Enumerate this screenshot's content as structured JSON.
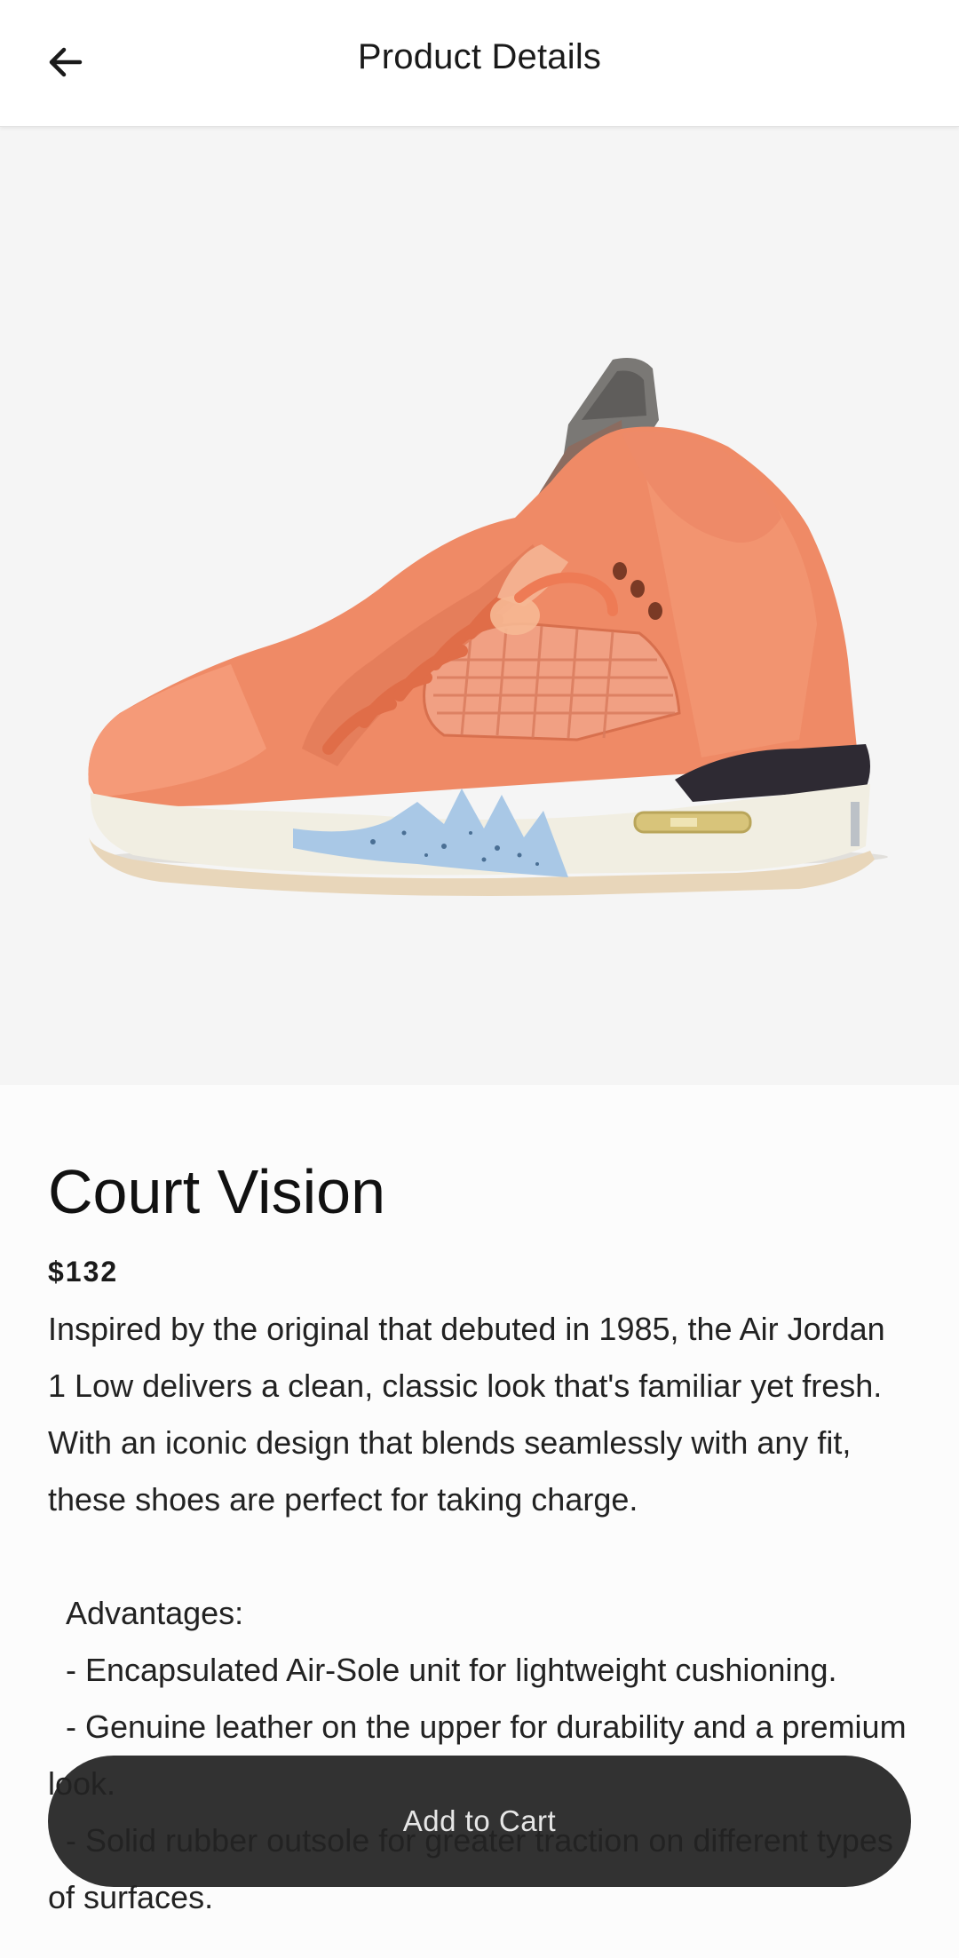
{
  "header": {
    "title": "Product Details",
    "back_icon": "arrow-left-icon"
  },
  "product": {
    "image": "orange-basketball-sneaker-image",
    "name": "Court Vision",
    "price": "$132",
    "description": "Inspired by the original that debuted in 1985, the Air Jordan 1 Low delivers a clean, classic look that's familiar yet fresh. With an iconic design that blends seamlessly with any fit, these shoes are perfect for taking charge.\n\n  Advantages:\n  - Encapsulated Air-Sole unit for lightweight cushioning.\n  - Genuine leather on the upper for durability and a premium look.\n  - Solid rubber outsole for greater traction on different types of surfaces."
  },
  "actions": {
    "add_to_cart_label": "Add to Cart"
  },
  "colors": {
    "shoe_upper": "#ef8a66",
    "midsole": "#f1eee2",
    "accent_blue": "#a9c8e6",
    "image_background": "#f5f5f5",
    "button_background": "#222222"
  }
}
